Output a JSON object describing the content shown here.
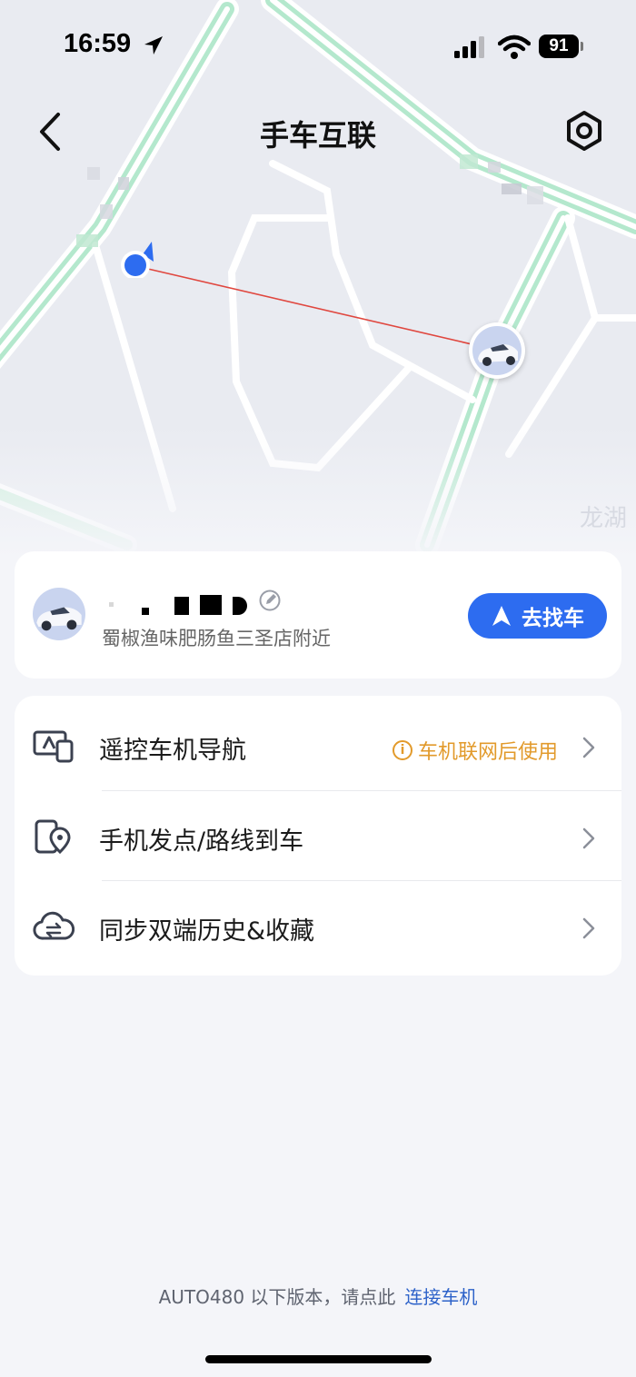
{
  "status_bar": {
    "time": "16:59",
    "battery": "91"
  },
  "header": {
    "title": "手车互联",
    "back_icon": "chevron-left-icon",
    "settings_icon": "hexagon-gear-icon"
  },
  "map": {
    "partial_label": "龙湖"
  },
  "car_card": {
    "location": "蜀椒渔味肥肠鱼三圣店附近",
    "find_car_label": "去找车"
  },
  "menu": {
    "items": [
      {
        "label": "遥控车机导航",
        "icon": "remote-screen-icon",
        "note": "车机联网后使用"
      },
      {
        "label": "手机发点/路线到车",
        "icon": "phone-location-icon"
      },
      {
        "label": "同步双端历史&收藏",
        "icon": "cloud-sync-icon"
      }
    ]
  },
  "footer": {
    "text": "AUTO480 以下版本，请点此",
    "link": "连接车机"
  },
  "colors": {
    "accent": "#2d6cf0",
    "warning": "#e29a2b",
    "road_green": "#a9e3c3",
    "route_line": "#e0473f"
  }
}
